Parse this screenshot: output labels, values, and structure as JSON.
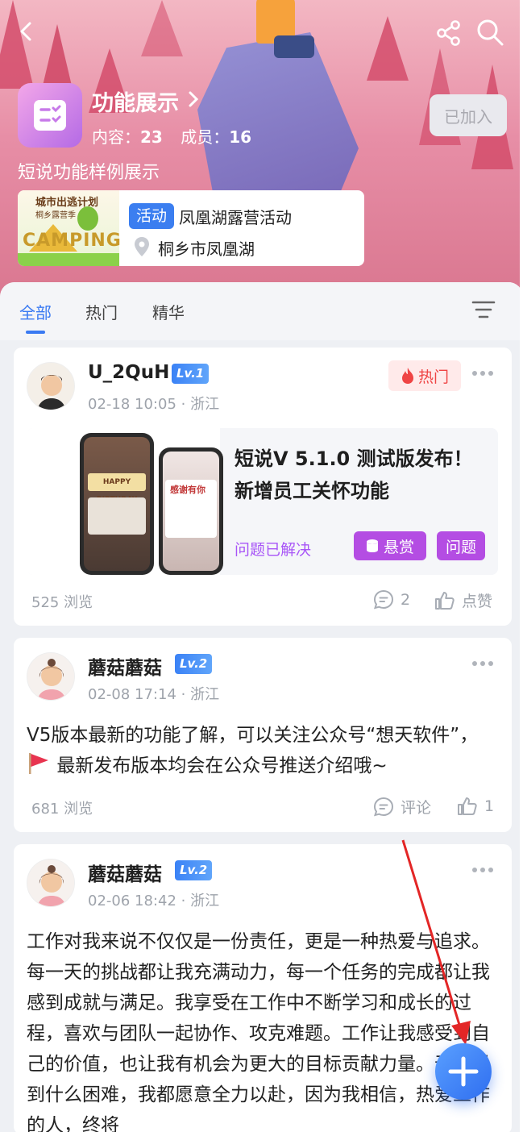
{
  "header": {
    "group_name": "功能展示",
    "stats": {
      "content_label": "内容：",
      "content_count": "23",
      "member_label": "成员：",
      "member_count": "16"
    },
    "joined_label": "已加入",
    "description": "短说功能样例展示",
    "activity": {
      "tag": "活动",
      "title": "凤凰湖露营活动",
      "location": "桐乡市凤凰湖",
      "thumb_text_top": "城市出逃计划",
      "thumb_text_sub": "桐乡露营季",
      "thumb_text_main": "CAMPING"
    }
  },
  "tabs": [
    {
      "label": "全部",
      "active": true
    },
    {
      "label": "热门",
      "active": false
    },
    {
      "label": "精华",
      "active": false
    }
  ],
  "posts": [
    {
      "username": "U_2QuH",
      "level": "Lv.1",
      "time": "02-18 10:05",
      "location": "浙江",
      "hot_label": "热门",
      "title": "短说V 5.1.0 测试版发布！新增员工关怀功能",
      "solved": "问题已解决",
      "reward": "悬赏",
      "question": "问题",
      "views": "525 浏览",
      "comments": "2",
      "likes": "点赞",
      "phone_texts": [
        "HAPPY BIRTHDAY",
        "感谢有你"
      ]
    },
    {
      "username": "蘑菇蘑菇",
      "level": "Lv.2",
      "time": "02-08 17:14",
      "location": "浙江",
      "text_a": "V5版本最新的功能了解，可以关注公众号“想天软件”，",
      "text_b": "最新发布版本均会在公众号推送介绍哦~",
      "views": "681 浏览",
      "comments": "评论",
      "likes": "1"
    },
    {
      "username": "蘑菇蘑菇",
      "level": "Lv.2",
      "time": "02-06 18:42",
      "location": "浙江",
      "text": "工作对我来说不仅仅是一份责任，更是一种热爱与追求。每一天的挑战都让我充满动力，每一个任务的完成都让我感到成就与满足。我享受在工作中不断学习和成长的过程，喜欢与团队一起协作、攻克难题。工作让我感受到自己的价值，也让我有机会为更大的目标贡献力量。无论遇到什么困难，我都愿意全力以赴，因为我相信，热爱工作的人，终将"
    }
  ],
  "icons": {
    "back": "chevron-left-icon",
    "share": "share-icon",
    "search": "search-icon",
    "filter": "filter-icon",
    "more": "more-icon",
    "fire": "fire-icon",
    "comment": "comment-icon",
    "like": "like-icon",
    "fab": "plus-icon",
    "location": "location-pin-icon",
    "coin": "coin-icon"
  },
  "colors": {
    "accent": "#3a7af2",
    "purple_tag": "#b44de3",
    "hot": "#ef4444",
    "header_pink": "#e78ea6"
  }
}
